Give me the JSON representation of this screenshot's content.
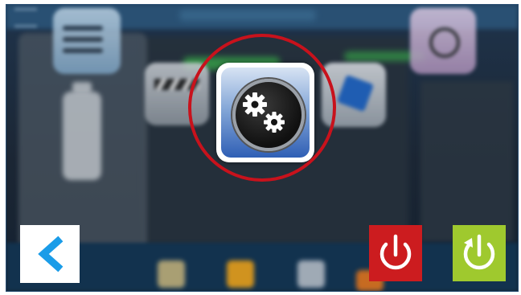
{
  "screen": {
    "background_apps": [
      {
        "name": "list-app",
        "icon": "list-icon"
      },
      {
        "name": "clapperboard-app",
        "icon": "clapperboard-icon"
      },
      {
        "name": "tools-app",
        "icon": "tools-icon"
      },
      {
        "name": "alarm-clock-app",
        "icon": "alarm-clock-icon"
      }
    ],
    "focused_app": {
      "name": "settings",
      "icon": "gears-icon",
      "highlighted": true
    },
    "bottom_controls": {
      "back": {
        "icon": "chevron-left-icon",
        "color": "#1a9ce8"
      },
      "power_off": {
        "icon": "power-icon",
        "color": "#cc1c1f"
      },
      "restart": {
        "icon": "power-restart-icon",
        "color": "#9fc92e"
      }
    }
  },
  "colors": {
    "highlight_ring": "#c8121c",
    "back_bg": "#ffffff",
    "power_off_bg": "#cc1c1f",
    "restart_bg": "#9fc92e"
  }
}
